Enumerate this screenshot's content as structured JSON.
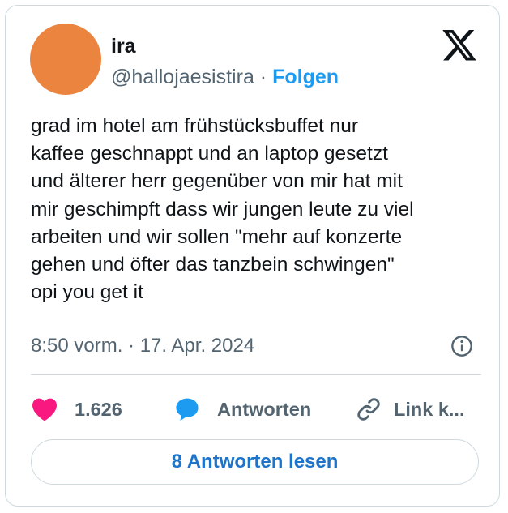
{
  "author": {
    "name": "ira",
    "handle": "@hallojaesistira",
    "separator": "·",
    "follow_label": "Folgen",
    "avatar_color": "#ea843e"
  },
  "brand_icon": "x-logo-icon",
  "tweet": {
    "text": "grad im hotel am frühstücksbuffet nur\nkaffee geschnappt und an laptop gesetzt\nund älterer herr gegenüber von mir hat mit\nmir geschimpft dass wir jungen leute zu viel\narbeiten und wir sollen \"mehr auf konzerte\ngehen und öfter das tanzbein schwingen\"\nopi you get it",
    "timestamp": "8:50 vorm. · 17. Apr. 2024"
  },
  "actions": {
    "likes": "1.626",
    "reply_label": "Antworten",
    "link_label": "Link k..."
  },
  "read_replies_label": "8 Antworten lesen",
  "colors": {
    "accent": "#1d9bf0",
    "like": "#f91880",
    "muted": "#536471",
    "border": "#cfd9de"
  }
}
